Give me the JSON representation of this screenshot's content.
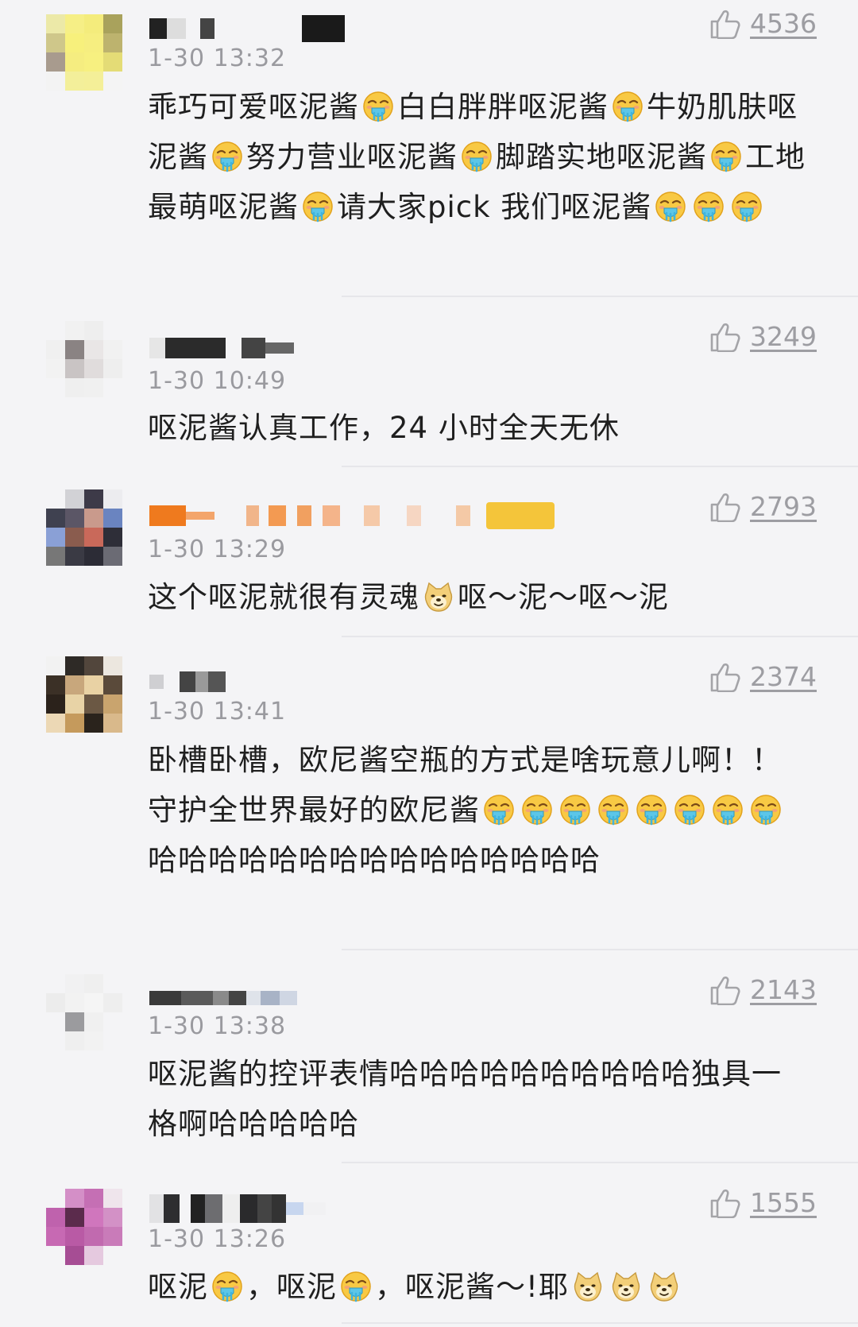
{
  "comments": [
    {
      "time": "1-30 13:32",
      "likes": "4536",
      "segments": [
        {
          "t": "乖巧可爱呕泥酱"
        },
        {
          "e": "vomit"
        },
        {
          "t": "白白胖胖呕泥酱"
        },
        {
          "e": "vomit"
        },
        {
          "t": "牛奶肌肤呕泥酱"
        },
        {
          "e": "vomit"
        },
        {
          "t": "努力营业呕泥酱"
        },
        {
          "e": "vomit"
        },
        {
          "t": "脚踏实地呕泥酱"
        },
        {
          "e": "vomit"
        },
        {
          "t": "工地最萌呕泥酱"
        },
        {
          "e": "vomit"
        },
        {
          "t": "请大家pick 我们呕泥酱"
        },
        {
          "e": "vomit"
        },
        {
          "e": "vomit"
        },
        {
          "e": "vomit"
        }
      ]
    },
    {
      "time": "1-30 10:49",
      "likes": "3249",
      "segments": [
        {
          "t": "呕泥酱认真工作，24 小时全天无休"
        }
      ]
    },
    {
      "time": "1-30 13:29",
      "likes": "2793",
      "segments": [
        {
          "t": "这个呕泥就很有灵魂"
        },
        {
          "e": "doge"
        },
        {
          "t": "呕～泥～呕～泥"
        }
      ]
    },
    {
      "time": "1-30 13:41",
      "likes": "2374",
      "segments": [
        {
          "t": "卧槽卧槽，欧尼酱空瓶的方式是啥玩意儿啊！！守护全世界最好的欧尼酱"
        },
        {
          "e": "vomit"
        },
        {
          "e": "vomit"
        },
        {
          "e": "vomit"
        },
        {
          "e": "vomit"
        },
        {
          "e": "vomit"
        },
        {
          "e": "vomit"
        },
        {
          "e": "vomit"
        },
        {
          "e": "vomit"
        },
        {
          "t": "哈哈哈哈哈哈哈哈哈哈哈哈哈哈哈"
        }
      ]
    },
    {
      "time": "1-30 13:38",
      "likes": "2143",
      "segments": [
        {
          "t": "呕泥酱的控评表情哈哈哈哈哈哈哈哈哈哈独具一格啊哈哈哈哈哈"
        }
      ]
    },
    {
      "time": "1-30 13:26",
      "likes": "1555",
      "segments": [
        {
          "t": "呕泥"
        },
        {
          "e": "vomit"
        },
        {
          "t": "，呕泥"
        },
        {
          "e": "vomit"
        },
        {
          "t": "，呕泥酱～!耶"
        },
        {
          "e": "doge"
        },
        {
          "e": "doge"
        },
        {
          "e": "doge"
        }
      ]
    }
  ],
  "colors": {
    "background": "#f4f4f6",
    "time": "#9a9a9f",
    "likes": "#9d9da2",
    "text": "#1f1f1f"
  },
  "icons": {
    "like": "thumbs-up-icon",
    "vomit": "vomit-emoji-icon",
    "doge": "doge-emoji-icon"
  }
}
